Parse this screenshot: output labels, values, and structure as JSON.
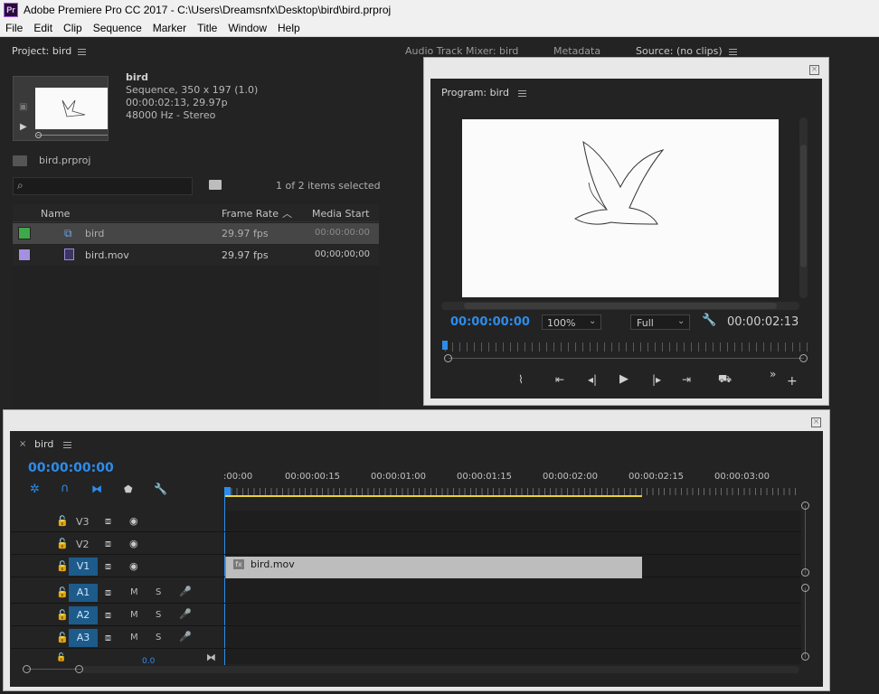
{
  "window": {
    "app_icon": "Pr",
    "title": "Adobe Premiere Pro CC 2017 - C:\\Users\\Dreamsnfx\\Desktop\\bird\\bird.prproj"
  },
  "menu": [
    {
      "label": "File"
    },
    {
      "label": "Edit"
    },
    {
      "label": "Clip"
    },
    {
      "label": "Sequence"
    },
    {
      "label": "Marker"
    },
    {
      "label": "Title"
    },
    {
      "label": "Window"
    },
    {
      "label": "Help"
    }
  ],
  "project": {
    "tab": "Project: bird",
    "clip_name": "bird",
    "clip_info": [
      "Sequence, 350 x 197 (1.0)",
      "00:00:02:13, 29.97p",
      "48000 Hz - Stereo"
    ],
    "file": "bird.prproj",
    "search_placeholder": "",
    "selection": "1 of 2 items selected",
    "columns": {
      "name": "Name",
      "frame_rate": "Frame Rate",
      "media_start": "Media Start"
    },
    "rows": [
      {
        "name": "bird",
        "frame_rate": "29.97 fps",
        "media_start": "00:00:00:00",
        "swatch": "#3ea84a",
        "icon": "sequence-icon"
      },
      {
        "name": "bird.mov",
        "frame_rate": "29.97 fps",
        "media_start": "00;00;00;00",
        "swatch": "#a58fe0",
        "icon": "film-icon"
      }
    ]
  },
  "upper_tabs": {
    "audio_mixer": "Audio Track Mixer: bird",
    "metadata": "Metadata",
    "source": "Source: (no clips)"
  },
  "program": {
    "tab": "Program: bird",
    "current_time": "00:00:00:00",
    "zoom": "100%",
    "quality": "Full",
    "duration": "00:00:02:13"
  },
  "timeline": {
    "tab": "bird",
    "close": "×",
    "current_time": "00:00:00:00",
    "ruler": [
      ":00:00",
      "00:00:00:15",
      "00:00:01:00",
      "00:00:01:15",
      "00:00:02:00",
      "00:00:02:15",
      "00:00:03:00"
    ],
    "tracks": {
      "v3": "V3",
      "v2": "V2",
      "v1": "V1",
      "a1": "A1",
      "a2": "A2",
      "a3": "A3",
      "m": "M",
      "s": "S"
    },
    "clip": {
      "label": "bird.mov",
      "fx": "fx"
    },
    "audio_level": "0.0"
  },
  "colors": {
    "accent_blue": "#2d8ceb",
    "track_active": "#1d5b8a",
    "work_area": "#e8d23a"
  }
}
